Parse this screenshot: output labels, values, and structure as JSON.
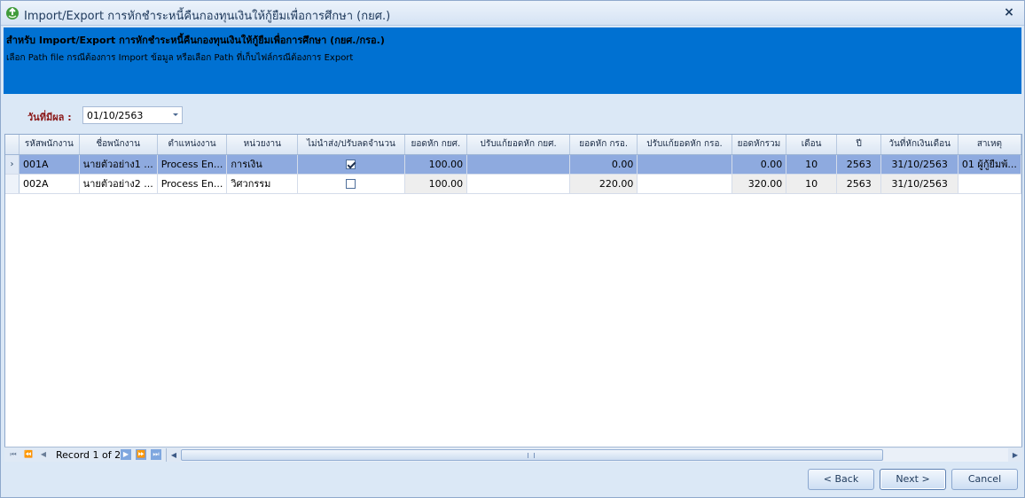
{
  "window": {
    "title": "Import/Export การหักชำระหนี้คืนกองทุนเงินให้กู้ยืมเพื่อการศึกษา (กยศ.)",
    "close_glyph": "×"
  },
  "banner": {
    "title": "สำหรับ Import/Export การหักชำระหนี้คืนกองทุนเงินให้กู้ยืมเพื่อการศึกษา (กยศ./กรอ.)",
    "subtitle": "เลือก Path file กรณีต้องการ Import ข้อมูล หรือเลือก Path ที่เก็บไฟล์กรณีต้องการ Export"
  },
  "filter": {
    "label": "วันที่มีผล :",
    "date_value": "01/10/2563"
  },
  "grid": {
    "columns": [
      "รหัสพนักงาน",
      "ชื่อพนักงาน",
      "ตำแหน่งงาน",
      "หน่วยงาน",
      "ไม่นำส่ง/ปรับลดจำนวน",
      "ยอดหัก กยศ.",
      "ปรับแก้ยอดหัก กยศ.",
      "ยอดหัก กรอ.",
      "ปรับแก้ยอดหัก กรอ.",
      "ยอดหักรวม",
      "เดือน",
      "ปี",
      "วันที่หักเงินเดือน",
      "สาเหตุ"
    ],
    "rows": [
      {
        "indicator": "›",
        "emp_id": "001A",
        "name": "นายตัวอย่าง1 ...",
        "position": "Process En...",
        "dept": "การเงิน",
        "checked": true,
        "kys": "100.00",
        "kys_adj": "",
        "kro": "0.00",
        "kro_adj": "",
        "total": "0.00",
        "month": "10",
        "year": "2563",
        "date": "31/10/2563",
        "reason": "01 ผู้กู้ยืมพ้..."
      },
      {
        "indicator": "",
        "emp_id": "002A",
        "name": "นายตัวอย่าง2 ...",
        "position": "Process En...",
        "dept": "วิศวกรรม",
        "checked": false,
        "kys": "100.00",
        "kys_adj": "",
        "kro": "220.00",
        "kro_adj": "",
        "total": "320.00",
        "month": "10",
        "year": "2563",
        "date": "31/10/2563",
        "reason": ""
      }
    ]
  },
  "navigator": {
    "record_text": "Record 1 of 2"
  },
  "buttons": {
    "back": "< Back",
    "next": "Next >",
    "cancel": "Cancel"
  },
  "colors": {
    "banner": "#0071d2",
    "selected_row": "#8eaadf",
    "date_label": "#8b1a1a"
  }
}
